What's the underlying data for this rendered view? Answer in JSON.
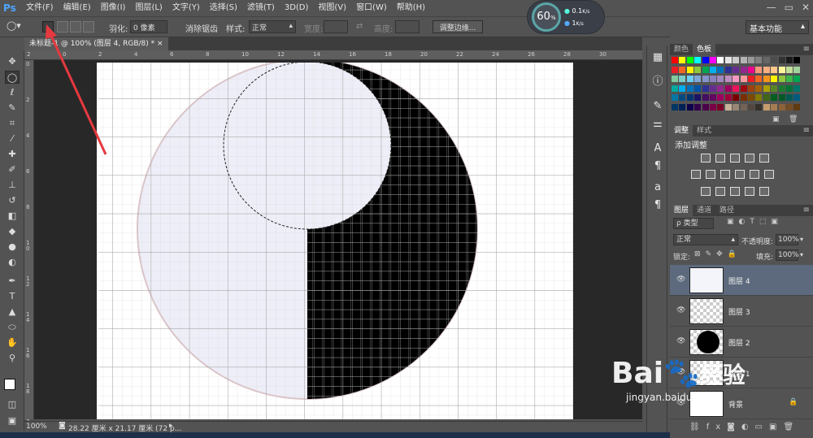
{
  "app": {
    "logo": "Ps"
  },
  "menu": [
    "文件(F)",
    "编辑(E)",
    "图像(I)",
    "图层(L)",
    "文字(Y)",
    "选择(S)",
    "滤镜(T)",
    "3D(D)",
    "视图(V)",
    "窗口(W)",
    "帮助(H)"
  ],
  "window_controls": {
    "minimize": "—",
    "restore": "▭",
    "close": "✕"
  },
  "options": {
    "feather_label": "羽化:",
    "feather_value": "0 像素",
    "antialias_label": "消除锯齿",
    "style_label": "样式:",
    "style_value": "正常",
    "width_label": "宽度:",
    "height_label": "高度:",
    "refine_button": "调整边缘...",
    "workspace": "基本功能"
  },
  "monitor": {
    "percent": "60",
    "percent_unit": "%",
    "upload": "0.1",
    "upload_unit": "K/s",
    "download": "1",
    "download_unit": "K/s"
  },
  "document": {
    "tab_title": "未标题-1 @ 100% (图层 4, RGB/8) *",
    "tab_close": "×"
  },
  "ruler_top": [
    "2",
    "0",
    "2",
    "4",
    "6",
    "8",
    "10",
    "12",
    "14",
    "16",
    "18",
    "20",
    "22",
    "24",
    "26",
    "28",
    "30"
  ],
  "ruler_left": [
    "0",
    "2",
    "4",
    "6",
    "8",
    "1 0",
    "1 2",
    "1 4",
    "1 6",
    "1 8",
    "2 0"
  ],
  "status": {
    "zoom": "100%",
    "dimensions": "28.22 厘米 x 21.17 厘米 (72 p..."
  },
  "colors": {
    "accent": "#e5393f",
    "panel_bg": "#535353",
    "selected_layer": "#5d6a7e",
    "gauge_ring": "#5aa6a8"
  },
  "swatches_panel": {
    "tabs": [
      "颜色",
      "色板"
    ],
    "active": 1
  },
  "swatches": [
    "#ff0000",
    "#ffff00",
    "#00ff00",
    "#00ffff",
    "#0000ff",
    "#ff00ff",
    "#ffffff",
    "#e6e6e6",
    "#cccccc",
    "#b3b3b3",
    "#999999",
    "#808080",
    "#666666",
    "#4d4d4d",
    "#333333",
    "#1a1a1a",
    "#000000",
    "#ed1c24",
    "#f26522",
    "#fff200",
    "#8dc63f",
    "#00a651",
    "#00aeef",
    "#0072bc",
    "#2e3192",
    "#662d91",
    "#92278f",
    "#ec008c",
    "#f7977a",
    "#f9ad81",
    "#fdc68a",
    "#fff79a",
    "#c4df9b",
    "#a3d39c",
    "#82ca9d",
    "#7bcdc8",
    "#6ecff6",
    "#7ea7d8",
    "#8493ca",
    "#8882be",
    "#a187be",
    "#bc8dbf",
    "#f49ac2",
    "#f6989d",
    "#ed1c24",
    "#f26522",
    "#f7941d",
    "#fff200",
    "#8dc63f",
    "#39b54a",
    "#00a651",
    "#00a99d",
    "#00aeef",
    "#0072bc",
    "#0054a6",
    "#2e3192",
    "#662d91",
    "#92278f",
    "#9e005d",
    "#ed145b",
    "#9e0b0f",
    "#a0410d",
    "#a36209",
    "#aba000",
    "#598527",
    "#1a7b30",
    "#007236",
    "#00746b",
    "#0076a3",
    "#004a80",
    "#003471",
    "#1b1464",
    "#440e62",
    "#630460",
    "#9e005d",
    "#9e0039",
    "#790000",
    "#7b2e00",
    "#7d4900",
    "#827b00",
    "#406618",
    "#005e20",
    "#005826",
    "#005952",
    "#005b7f",
    "#003663",
    "#002157",
    "#0d004c",
    "#32004b",
    "#4b0049",
    "#7b0046",
    "#7a0026",
    "#c7b299",
    "#998675",
    "#736357",
    "#534741",
    "#37302a",
    "#c69c6d",
    "#a67c52",
    "#8c6239",
    "#754c24",
    "#603913"
  ],
  "adjust_panel": {
    "tabs": [
      "调整",
      "样式"
    ],
    "active": 0,
    "title": "添加调整"
  },
  "layers_panel": {
    "tabs": [
      "图层",
      "通道",
      "路径"
    ],
    "active": 0,
    "filter": "ρ 类型",
    "blend_mode": "正常",
    "opacity_label": "不透明度:",
    "opacity": "100%",
    "lock_label": "锁定:",
    "fill_label": "填充:",
    "fill": "100%",
    "layers": [
      {
        "name": "图层 4",
        "thumb": "light",
        "selected": true
      },
      {
        "name": "图层 3",
        "thumb": "checker",
        "selected": false
      },
      {
        "name": "图层 2",
        "thumb": "circle",
        "selected": false
      },
      {
        "name": "图层 1",
        "thumb": "checker",
        "selected": false
      },
      {
        "name": "背景",
        "thumb": "white",
        "selected": false
      }
    ]
  },
  "watermark": {
    "brand": "Bai",
    "brand2": "经验",
    "url": "jingyan.baidu.com"
  }
}
